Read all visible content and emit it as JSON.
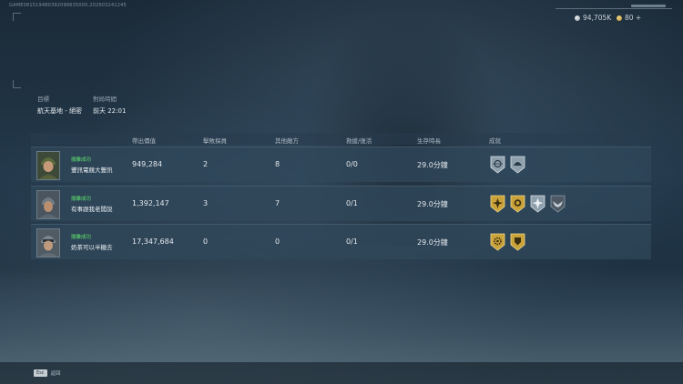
{
  "match_id": "GAME081519480392098635000,202603241245",
  "currency": {
    "silver": {
      "value": "94,705K",
      "icon": "silver-coin-icon"
    },
    "gold": {
      "value": "80 +",
      "icon": "gold-coin-icon"
    }
  },
  "info": {
    "target_label": "目標",
    "target_value": "航天基地 - 絕密",
    "time_label": "對局時間",
    "time_value": "前天 22:01"
  },
  "columns": [
    "帶出價值",
    "擊敗探員",
    "其他敵方",
    "救援/復活",
    "生存時長",
    "成就"
  ],
  "players": [
    {
      "status": "撤離成功",
      "name": "豐訊電競大豐訊",
      "value": "949,284",
      "kills": "2",
      "other": "8",
      "rescue": "0/0",
      "survival": "29.0分鐘",
      "badges": [
        {
          "type": "silver",
          "icon": "crosshair-badge-icon"
        },
        {
          "type": "silver",
          "icon": "helmet-badge-icon"
        }
      ]
    },
    {
      "status": "撤離成功",
      "name": "有事跟我老闆說",
      "value": "1,392,147",
      "kills": "3",
      "other": "7",
      "rescue": "0/1",
      "survival": "29.0分鐘",
      "badges": [
        {
          "type": "gold",
          "icon": "burst-badge-icon"
        },
        {
          "type": "gold",
          "icon": "medal-badge-icon"
        },
        {
          "type": "silver",
          "icon": "star-burst-badge-icon"
        },
        {
          "type": "dark",
          "icon": "wing-badge-icon"
        }
      ]
    },
    {
      "status": "撤離成功",
      "name": "奶茶可以半糖去",
      "value": "17,347,684",
      "kills": "0",
      "other": "0",
      "rescue": "0/1",
      "survival": "29.0分鐘",
      "badges": [
        {
          "type": "gold",
          "icon": "gear-badge-icon"
        },
        {
          "type": "gold",
          "icon": "shield-badge-icon"
        }
      ]
    }
  ],
  "bottom": {
    "key": "Esc",
    "label": "返回"
  },
  "colors": {
    "success": "#5de06d",
    "gold": "#c9a23a",
    "silver": "#8fa0ad"
  }
}
